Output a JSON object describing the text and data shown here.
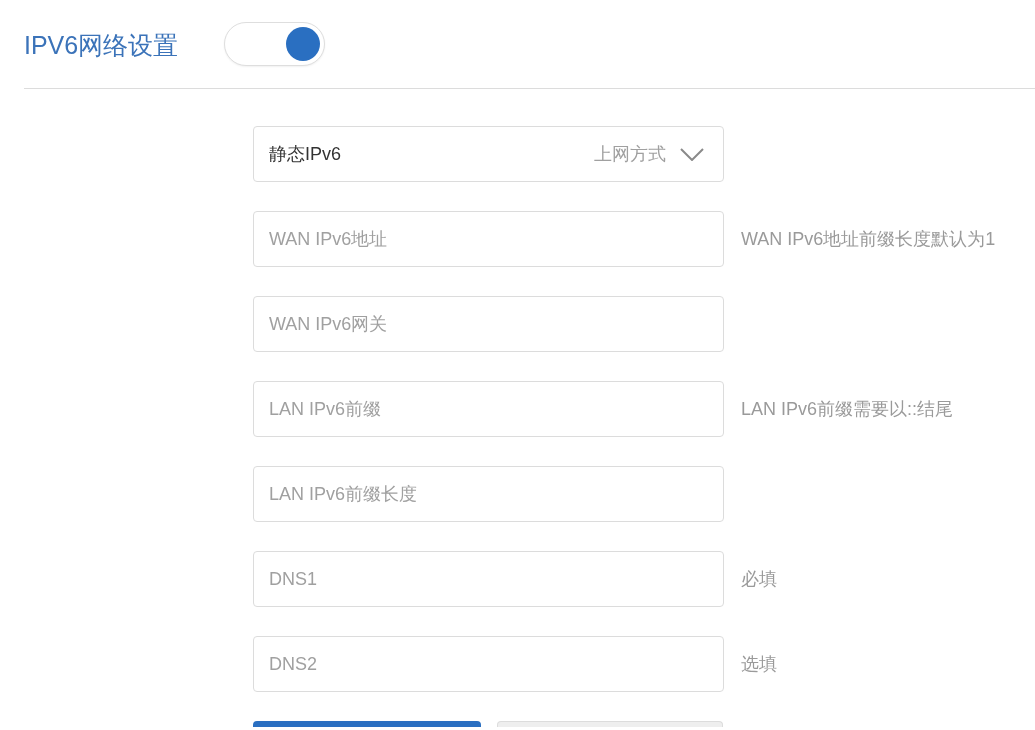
{
  "header": {
    "title": "IPV6网络设置",
    "toggle": {
      "on": true
    }
  },
  "connection_type": {
    "value": "静态IPv6",
    "label": "上网方式"
  },
  "fields": [
    {
      "placeholder": "WAN IPv6地址",
      "hint": "WAN IPv6地址前缀长度默认为1"
    },
    {
      "placeholder": "WAN IPv6网关"
    },
    {
      "placeholder": "LAN IPv6前缀",
      "hint": "LAN IPv6前缀需要以::结尾"
    },
    {
      "placeholder": "LAN IPv6前缀长度"
    },
    {
      "placeholder": "DNS1",
      "hint": "必填"
    },
    {
      "placeholder": "DNS2",
      "hint": "选填"
    }
  ],
  "buttons": [
    {
      "kind": "primary"
    },
    {
      "kind": "secondary"
    }
  ]
}
